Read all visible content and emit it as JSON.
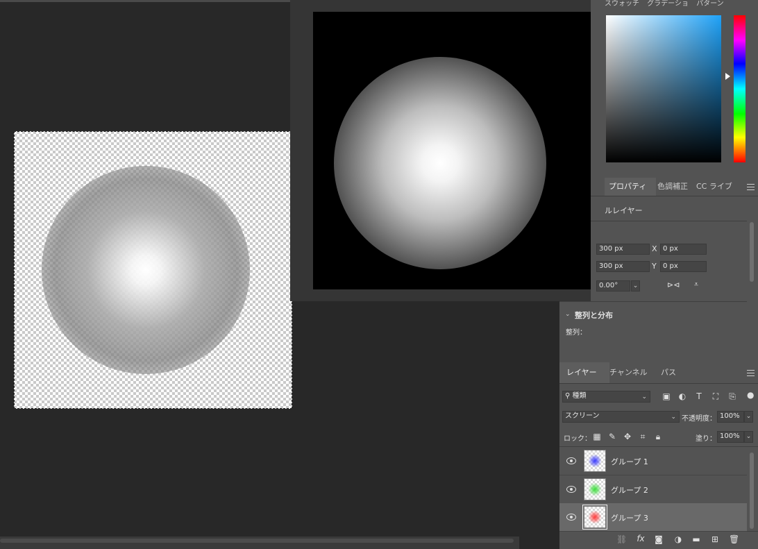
{
  "colors": {
    "color_field_hue": "#1fa2f8",
    "layer_thumb_blue": "#3a3aff",
    "layer_thumb_green": "#3adf3a",
    "layer_thumb_red": "#ff3a3a"
  },
  "color_panel": {
    "tabs": [
      "スウォッチ",
      "グラデーショ",
      "パターン"
    ]
  },
  "properties_panel": {
    "tabs": [
      "プロパティ",
      "色調補正",
      "CC ライブ"
    ],
    "layer_kind": "ルレイヤー",
    "width_value": "300 px",
    "height_value": "300 px",
    "x_label": "X",
    "x_value": "0 px",
    "y_label": "Y",
    "y_value": "0 px",
    "angle_value": "0.00°",
    "align_section_title": "整列と分布",
    "align_label": "整列："
  },
  "layers_panel": {
    "tabs": [
      "レイヤー",
      "チャンネル",
      "パス"
    ],
    "filter_kind": "種類",
    "blend_mode": "スクリーン",
    "opacity_label": "不透明度：",
    "opacity_value": "100%",
    "lock_label": "ロック：",
    "fill_label": "塗り：",
    "fill_value": "100%",
    "layers": [
      {
        "name": "グループ 1",
        "thumb": "blue",
        "visible": true,
        "selected": false
      },
      {
        "name": "グループ 2",
        "thumb": "green",
        "visible": true,
        "selected": false
      },
      {
        "name": "グループ 3",
        "thumb": "red",
        "visible": true,
        "selected": true
      }
    ],
    "footer_icons": [
      "link-icon",
      "fx-icon",
      "mask-icon",
      "adjustment-icon",
      "folder-icon",
      "new-layer-icon",
      "trash-icon"
    ],
    "fx_label": "fx"
  }
}
